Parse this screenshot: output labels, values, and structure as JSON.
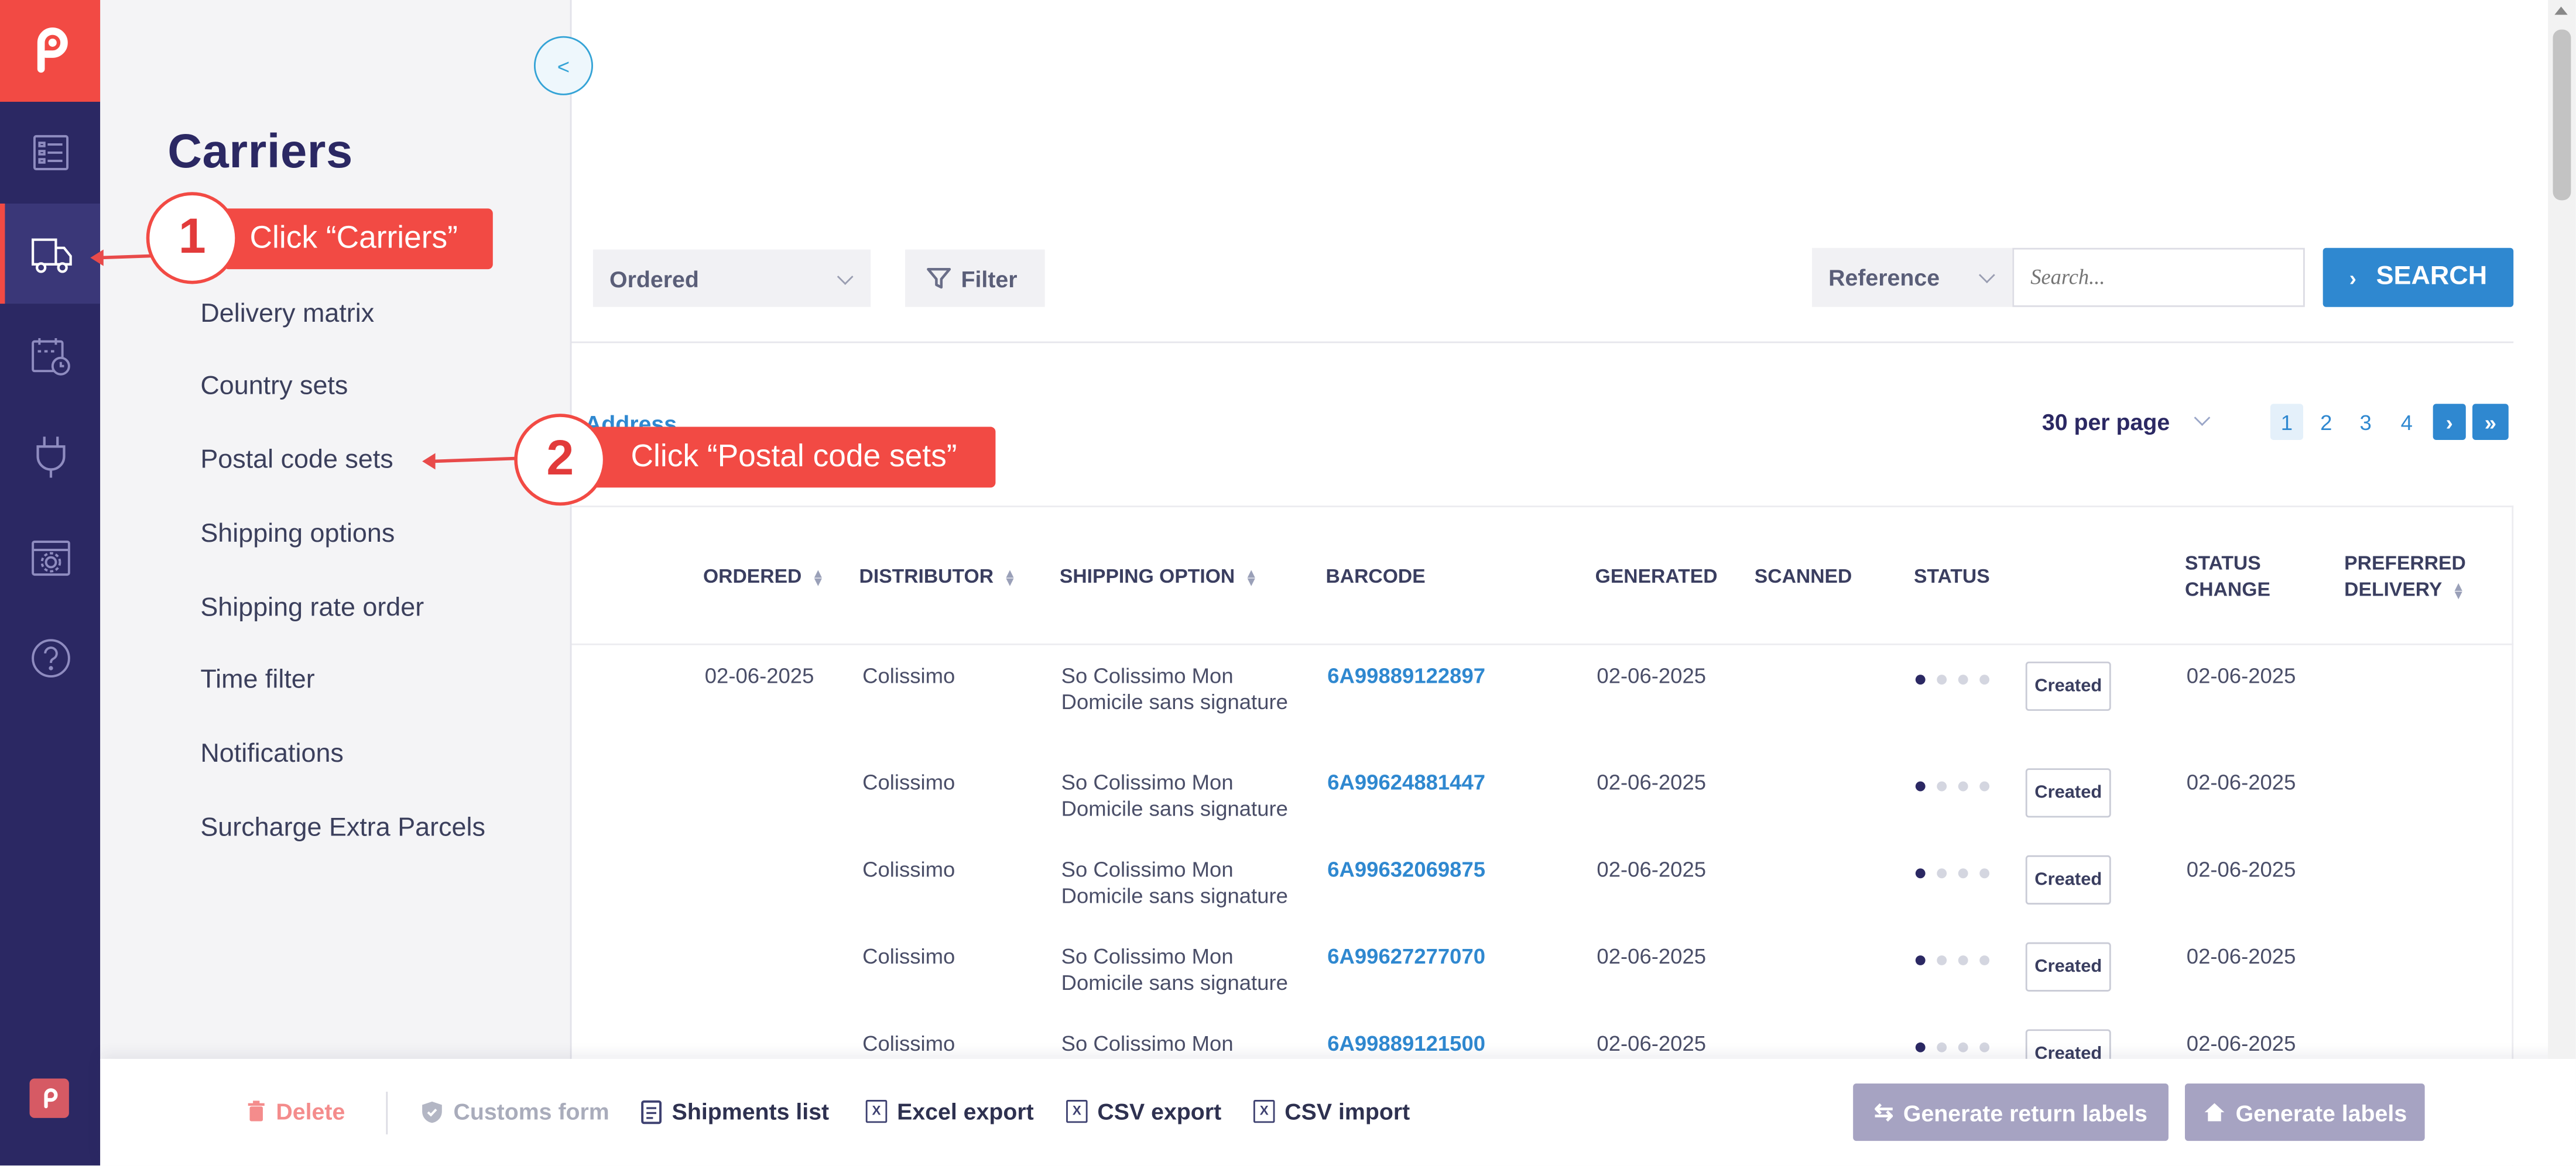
{
  "sidebar": {
    "title": "Carriers",
    "items": [
      {
        "label": "Delivery matrix"
      },
      {
        "label": "Country sets"
      },
      {
        "label": "Postal code sets"
      },
      {
        "label": "Shipping options"
      },
      {
        "label": "Shipping rate order"
      },
      {
        "label": "Time filter"
      },
      {
        "label": "Notifications"
      },
      {
        "label": "Surcharge Extra Parcels"
      }
    ],
    "collapse_label": "<"
  },
  "rail": {
    "icons": [
      "logo-icon",
      "orders-list-icon",
      "carriers-truck-icon",
      "calendar-clock-icon",
      "plug-icon",
      "window-settings-icon",
      "help-icon"
    ]
  },
  "toolbar": {
    "status_select": "Ordered",
    "filter_label": "Filter",
    "search_field_select": "Reference",
    "search_placeholder": "Search...",
    "search_button": "SEARCH"
  },
  "list_header": {
    "address_link": "Address",
    "per_page": "30 per page",
    "pages": [
      "1",
      "2",
      "3",
      "4"
    ],
    "current_page": "1",
    "next": "›",
    "last": "»"
  },
  "table": {
    "columns": {
      "ordered": "ORDERED",
      "distributor": "DISTRIBUTOR",
      "shipping_option": "SHIPPING OPTION",
      "barcode": "BARCODE",
      "generated": "GENERATED",
      "scanned": "SCANNED",
      "status": "STATUS",
      "status_change_1": "STATUS",
      "status_change_2": "CHANGE",
      "preferred_1": "PREFERRED",
      "preferred_2": "DELIVERY"
    },
    "rows": [
      {
        "ordered": "02-06-2025",
        "distributor": "Colissimo",
        "option1": "So Colissimo Mon",
        "option2": "Domicile sans signature",
        "barcode": "6A99889122897",
        "generated": "02-06-2025",
        "status": "Created",
        "status_change": "02-06-2025"
      },
      {
        "ordered": "",
        "distributor": "Colissimo",
        "option1": "So Colissimo Mon",
        "option2": "Domicile sans signature",
        "barcode": "6A99624881447",
        "generated": "02-06-2025",
        "status": "Created",
        "status_change": "02-06-2025"
      },
      {
        "ordered": "",
        "distributor": "Colissimo",
        "option1": "So Colissimo Mon",
        "option2": "Domicile sans signature",
        "barcode": "6A99632069875",
        "generated": "02-06-2025",
        "status": "Created",
        "status_change": "02-06-2025"
      },
      {
        "ordered": "",
        "distributor": "Colissimo",
        "option1": "So Colissimo Mon",
        "option2": "Domicile sans signature",
        "barcode": "6A99627277070",
        "generated": "02-06-2025",
        "status": "Created",
        "status_change": "02-06-2025"
      },
      {
        "ordered": "",
        "distributor": "Colissimo",
        "option1": "So Colissimo Mon",
        "option2": "",
        "barcode": "6A99889121500",
        "generated": "02-06-2025",
        "status": "Created",
        "status_change": "02-06-2025"
      }
    ]
  },
  "actions": {
    "delete": "Delete",
    "customs": "Customs form",
    "shipments_list": "Shipments list",
    "excel_export": "Excel export",
    "csv_export": "CSV export",
    "csv_import": "CSV import",
    "generate_return": "Generate return labels",
    "generate_labels": "Generate labels"
  },
  "callouts": {
    "one": {
      "number": "1",
      "text": "Click “Carriers”"
    },
    "two": {
      "number": "2",
      "text": "Click “Postal code sets”"
    }
  },
  "colors": {
    "brand": "#f24a44",
    "rail": "#2b2863",
    "accent": "#2f88d0"
  }
}
